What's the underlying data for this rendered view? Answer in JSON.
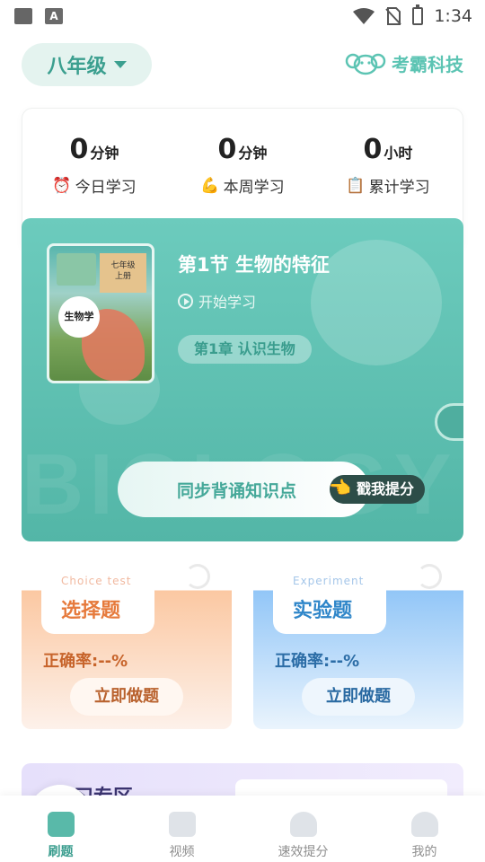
{
  "status_bar": {
    "time": "1:34",
    "left_icons": [
      "image-icon",
      "a-icon"
    ],
    "right_icons": [
      "wifi-icon",
      "no-sim-icon",
      "battery-charging-icon"
    ]
  },
  "header": {
    "grade": "八年级",
    "brand": "考霸科技"
  },
  "stats": [
    {
      "value": "0",
      "unit": "分钟",
      "label": "今日学习",
      "icon": "alarm-clock-icon"
    },
    {
      "value": "0",
      "unit": "分钟",
      "label": "本周学习",
      "icon": "flexed-arm-icon"
    },
    {
      "value": "0",
      "unit": "小时",
      "label": "累计学习",
      "icon": "clipboard-icon"
    }
  ],
  "hero": {
    "book": {
      "tag_line1": "七年级",
      "tag_line2": "上册",
      "subject": "生物学"
    },
    "lesson_title": "第1节 生物的特征",
    "start_label": "开始学习",
    "chapter": "第1章 认识生物",
    "recite_button": "同步背诵知识点",
    "hint": "戳我提分",
    "watermark": "BIOLOGY"
  },
  "practice": [
    {
      "en": "Choice test",
      "cn": "选择题",
      "rate": "正确率:--%",
      "button": "立即做题"
    },
    {
      "en": "Experiment",
      "cn": "实验题",
      "rate": "正确率:--%",
      "button": "立即做题"
    }
  ],
  "review": {
    "title": "复习专区"
  },
  "nav": [
    {
      "label": "刷题",
      "icon": "home-icon",
      "active": true
    },
    {
      "label": "视频",
      "icon": "video-icon",
      "active": false
    },
    {
      "label": "速效提分",
      "icon": "rocket-icon",
      "active": false
    },
    {
      "label": "我的",
      "icon": "profile-icon",
      "active": false
    }
  ],
  "colors": {
    "accent": "#53b6a7",
    "choice": "#e67a3c",
    "experiment": "#2f86c9"
  }
}
